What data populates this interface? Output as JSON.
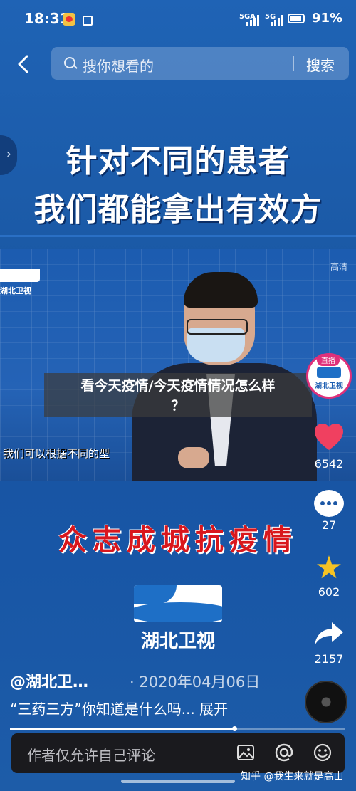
{
  "status_bar": {
    "time": "18:31",
    "signal1": "5GA",
    "signal2": "5G",
    "battery": "91%"
  },
  "search": {
    "placeholder": "搜你想看的",
    "button": "搜索"
  },
  "headline": {
    "line1": "针对不同的患者",
    "line2": "我们都能拿出有效方",
    "divider_color": "#2a6fc4"
  },
  "video": {
    "logo_text": "湖北卫视",
    "quality": "高清",
    "subtitle": "我们可以根据不同的型"
  },
  "overlay_title": {
    "line1": "看今天疫情/今天疫情情况怎么样",
    "line2": "？"
  },
  "slogan": "众志成城抗疫情",
  "brand_logo": "湖北卫视",
  "live": {
    "badge": "直播",
    "name": "湖北卫视"
  },
  "actions": {
    "likes": "6542",
    "comments": "27",
    "favorites": "602",
    "shares": "2157"
  },
  "post": {
    "author": "@湖北卫…",
    "date": "· 2020年04月06日",
    "description": "“三药三方”你知道是什么吗... 展开"
  },
  "progress": {
    "fraction": 0.67
  },
  "comment_bar": {
    "placeholder": "作者仅允许自己评论"
  },
  "watermark": "知乎 @我生来就是高山",
  "colors": {
    "accent_red": "#d9171d",
    "like_red": "#f04060",
    "star_yellow": "#f5c324"
  }
}
